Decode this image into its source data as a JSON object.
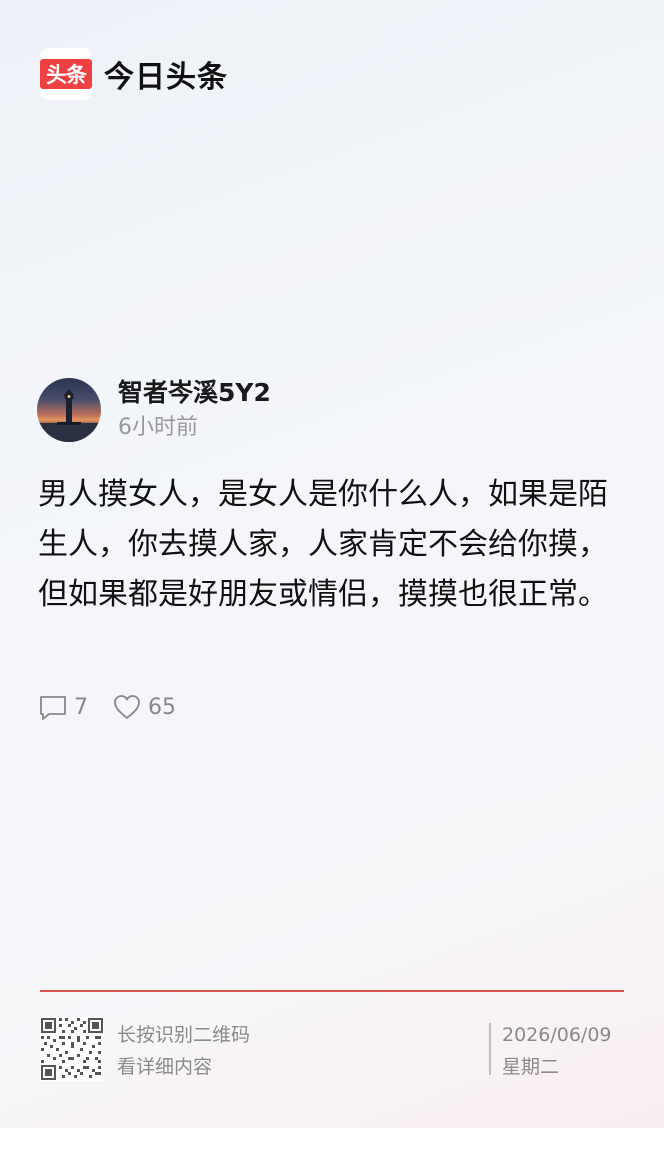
{
  "brand": {
    "logo_text": "头条",
    "name": "今日头条"
  },
  "author": {
    "avatar_icon": "lighthouse-sunset-avatar",
    "name": "智者岑溪5Y2",
    "time": "6小时前"
  },
  "post": {
    "content": "男人摸女人，是女人是你什么人，如果是陌生人，你去摸人家，人家肯定不会给你摸，但如果都是好朋友或情侣，摸摸也很正常。"
  },
  "stats": {
    "comment_icon": "comment-icon",
    "comments": "7",
    "like_icon": "heart-icon",
    "likes": "65"
  },
  "footer": {
    "qr_icon": "qr-code-icon",
    "qr_line1": "长按识别二维码",
    "qr_line2": "看详细内容",
    "date": "2026/06/09",
    "weekday": "星期二"
  },
  "colors": {
    "brand_red": "#f04142",
    "divider_red": "#d9534f",
    "text_primary": "#111111",
    "text_secondary": "#999999"
  }
}
